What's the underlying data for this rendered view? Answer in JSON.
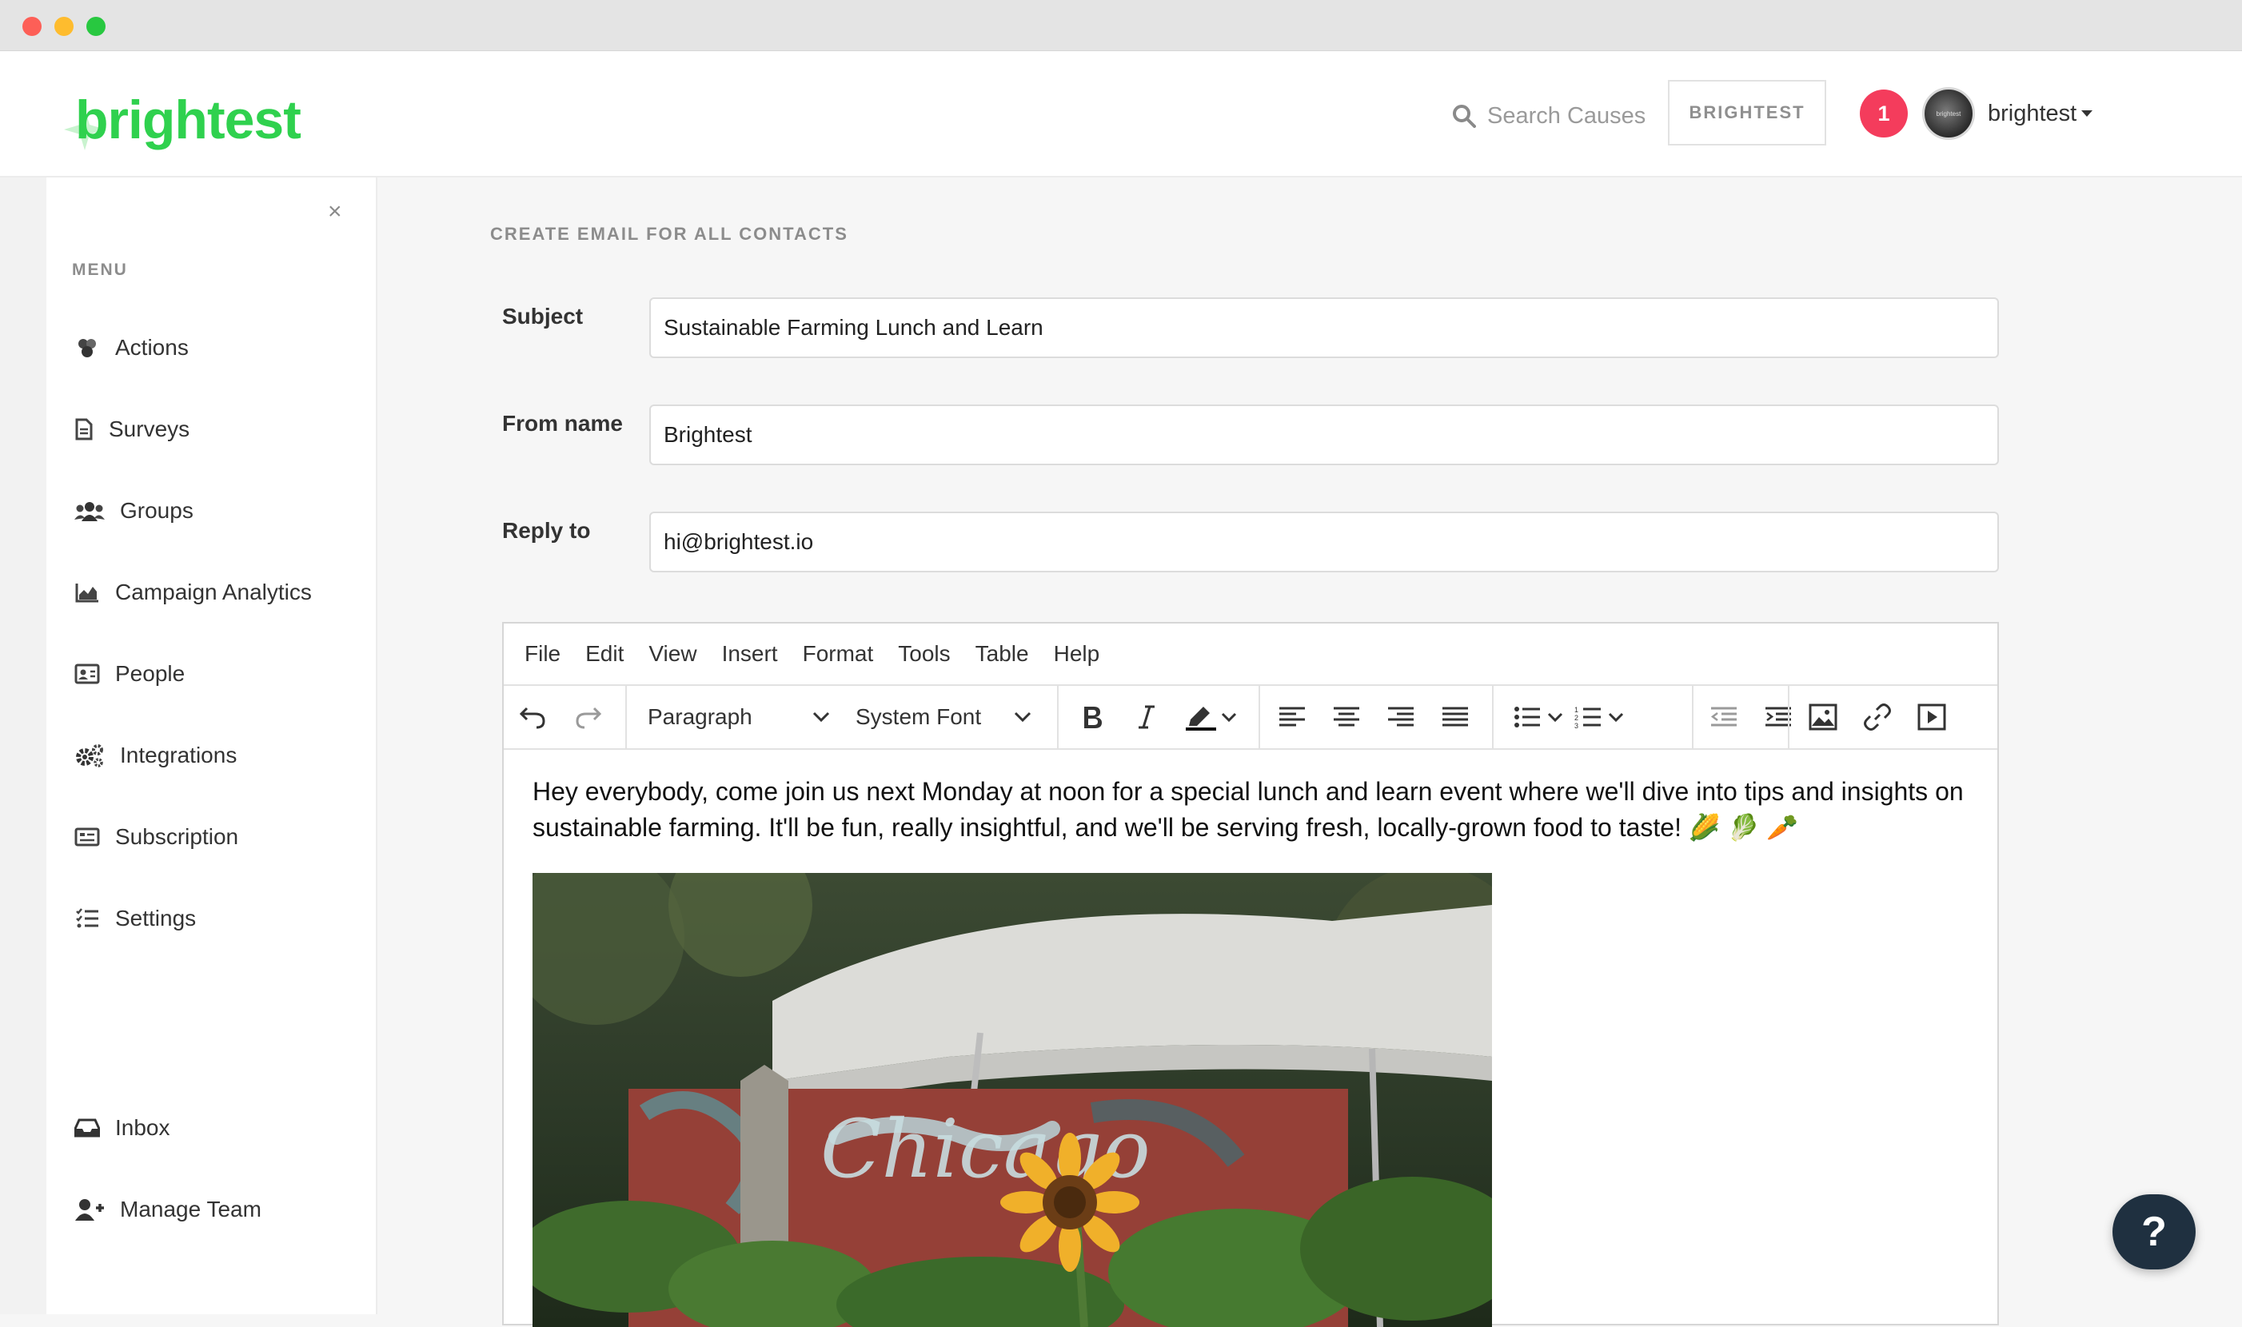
{
  "header": {
    "logo_text": "brightest",
    "search_placeholder": "Search Causes",
    "org_button": "BRIGHTEST",
    "notification_count": "1",
    "avatar_text": "brightest",
    "username": "brightest"
  },
  "sidebar": {
    "close": "×",
    "menu_title": "MENU",
    "items": [
      {
        "label": "Actions",
        "icon": "actions-icon"
      },
      {
        "label": "Surveys",
        "icon": "survey-icon"
      },
      {
        "label": "Groups",
        "icon": "groups-icon"
      },
      {
        "label": "Campaign Analytics",
        "icon": "chart-icon"
      },
      {
        "label": "People",
        "icon": "id-card-icon"
      },
      {
        "label": "Integrations",
        "icon": "cogs-icon"
      },
      {
        "label": "Subscription",
        "icon": "receipt-icon"
      },
      {
        "label": "Settings",
        "icon": "list-icon"
      }
    ],
    "bottom_items": [
      {
        "label": "Inbox",
        "icon": "inbox-icon"
      },
      {
        "label": "Manage Team",
        "icon": "user-plus-icon"
      }
    ]
  },
  "main": {
    "page_title": "CREATE EMAIL FOR ALL CONTACTS",
    "fields": {
      "subject": {
        "label": "Subject",
        "value": "Sustainable Farming Lunch and Learn"
      },
      "from_name": {
        "label": "From name",
        "value": "Brightest"
      },
      "reply_to": {
        "label": "Reply to",
        "value": "hi@brightest.io"
      }
    },
    "editor": {
      "menu": [
        "File",
        "Edit",
        "View",
        "Insert",
        "Format",
        "Tools",
        "Table",
        "Help"
      ],
      "block_format": "Paragraph",
      "font_family": "System Font",
      "body_text": "Hey everybody, come join us next Monday at noon for a special lunch and learn event where we'll dive into tips and insights on sustainable farming. It'll be fun, really insightful, and we'll be serving fresh, locally-grown food to taste! 🌽 🥬 🥕",
      "image_sign_text": "Chicago"
    }
  },
  "help_button": "?",
  "colors": {
    "brand_green": "#2fd14e",
    "notification_red": "#f43c5c",
    "help_button_bg": "#1f3040"
  }
}
